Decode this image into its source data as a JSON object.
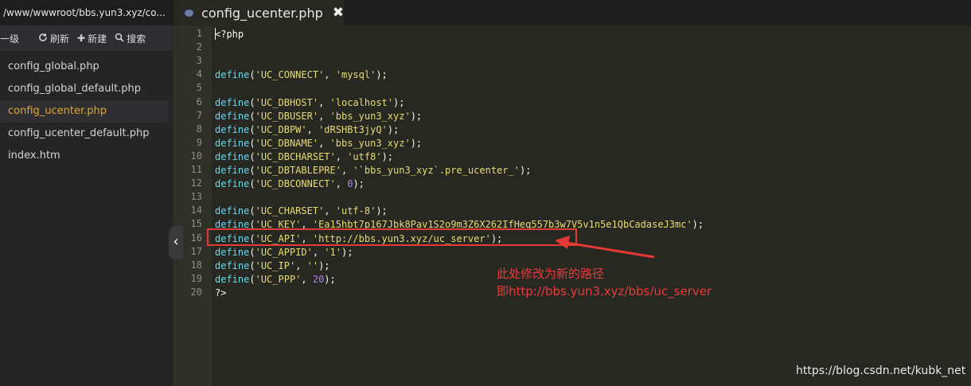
{
  "sidebar": {
    "path": "/www/wwwroot/bbs.yun3.xyz/co...",
    "toolbar": {
      "up_label": "一级",
      "refresh_label": "刷新",
      "new_label": "新建",
      "search_label": "搜索"
    },
    "files": [
      {
        "name": "config_global.php"
      },
      {
        "name": "config_global_default.php"
      },
      {
        "name": "config_ucenter.php",
        "active": true
      },
      {
        "name": "config_ucenter_default.php"
      },
      {
        "name": "index.htm"
      }
    ]
  },
  "tab": {
    "title": "config_ucenter.php"
  },
  "editor": {
    "lines": [
      {
        "n": "1",
        "text": "<?php"
      },
      {
        "n": "2",
        "text": ""
      },
      {
        "n": "3",
        "text": ""
      },
      {
        "n": "4",
        "text": "define('UC_CONNECT', 'mysql');"
      },
      {
        "n": "5",
        "text": ""
      },
      {
        "n": "6",
        "text": "define('UC_DBHOST', 'localhost');"
      },
      {
        "n": "7",
        "text": "define('UC_DBUSER', 'bbs_yun3_xyz');"
      },
      {
        "n": "8",
        "text": "define('UC_DBPW', 'dRSHBt3jyQ');"
      },
      {
        "n": "9",
        "text": "define('UC_DBNAME', 'bbs_yun3_xyz');"
      },
      {
        "n": "10",
        "text": "define('UC_DBCHARSET', 'utf8');"
      },
      {
        "n": "11",
        "text": "define('UC_DBTABLEPRE', '`bbs_yun3_xyz`.pre_ucenter_');"
      },
      {
        "n": "12",
        "text": "define('UC_DBCONNECT', 0);"
      },
      {
        "n": "13",
        "text": ""
      },
      {
        "n": "14",
        "text": "define('UC_CHARSET', 'utf-8');"
      },
      {
        "n": "15",
        "text": "define('UC_KEY', 'Ea15hbt7p167Jbk8Pav1S2o9m3Z6X262IfHeq557b3w7V5v1n5e1QbCadaseJ3mc');"
      },
      {
        "n": "16",
        "text": "define('UC_API', 'http://bbs.yun3.xyz/uc_server');"
      },
      {
        "n": "17",
        "text": "define('UC_APPID', '1');"
      },
      {
        "n": "18",
        "text": "define('UC_IP', '');"
      },
      {
        "n": "19",
        "text": "define('UC_PPP', 20);"
      },
      {
        "n": "20",
        "text": "?>"
      }
    ]
  },
  "annotation": {
    "line1": "此处修改为新的路径",
    "line2": "即http://bbs.yun3.xyz/bbs/uc_server",
    "color": "#e33a35"
  },
  "watermark": "https://blog.csdn.net/kubk_net",
  "icons": {
    "refresh": "refresh-icon",
    "new": "plus-icon",
    "search": "search-icon",
    "close": "close-icon",
    "collapse": "chevron-left-icon"
  }
}
